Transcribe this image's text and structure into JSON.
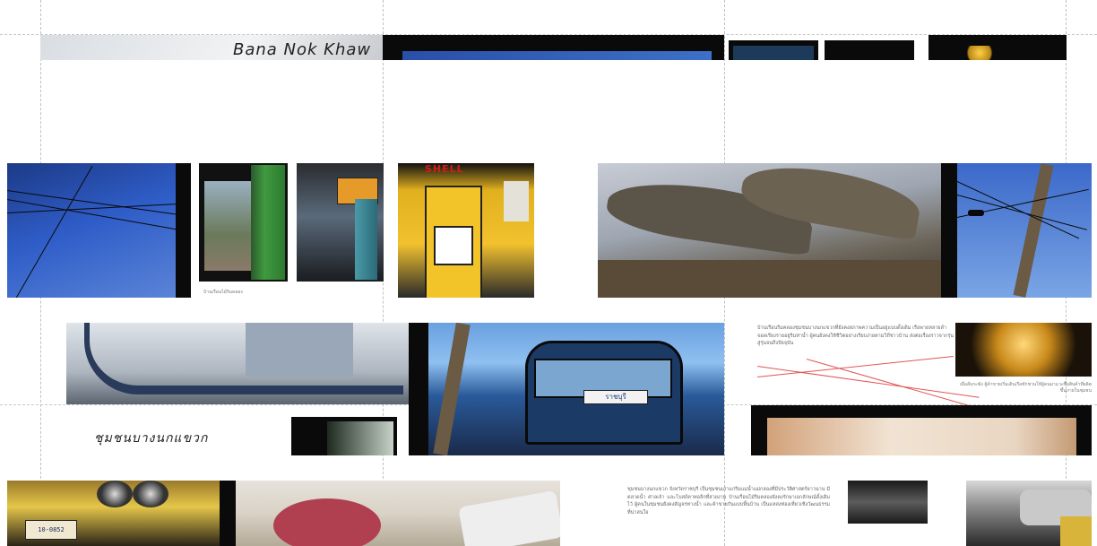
{
  "spread_title_script": "Bana Nok Khaw",
  "section_title_thai": "ชุมชนบางนกแขวก",
  "caption_row2_left": "บ้านเรือนไม้ริมคลอง",
  "caption_row3_right": "เมื่อลั่นระฆัง ผู้ค้าขายเริ่มเดินเรือชักชวนให้ผู้คนมาแวะซื้อสินค้าที่ผลิตขึ้นภายในชุมชน",
  "paragraph_row3": "บ้านเรือนริมคลองชุมชนบางนกแขวกที่ยังคงสภาพความเป็นอยู่แบบดั้งเดิม เรือพายหลายลำจอดเรียงรายอยู่ริมท่าน้ำ ผู้คนยังคงใช้ชีวิตอย่างเรียบง่ายตามวิถีชาวบ้าน ส่งต่อเรื่องราวจากรุ่นสู่รุ่นจนถึงปัจจุบัน",
  "paragraph_row4": "ชุมชนบางนกแขวก จังหวัดราชบุรี เป็นชุมชนเก่าแก่ริมแม่น้ำแม่กลองที่มีประวัติศาสตร์ยาวนาน มีตลาดน้ำ ศาลเจ้า และโบสถ์คาทอลิกที่สวยงาม บ้านเรือนไม้ริมคลองยังคงรักษาเอกลักษณ์ดั้งเดิมไว้ ผู้คนในชุมชนยังคงสัญจรทางน้ำ และค้าขายกันแบบพื้นบ้าน เป็นแหล่งท่องเที่ยวเชิงวัฒนธรรมที่น่าสนใจ",
  "shell_sign": "SHELL",
  "bus_sign_thai": "ราชบุรี",
  "plate_text": "10-0852",
  "colors": {
    "guide": "#bfbfbf",
    "accent_line": "#e25555",
    "paper": "#ffffff"
  }
}
